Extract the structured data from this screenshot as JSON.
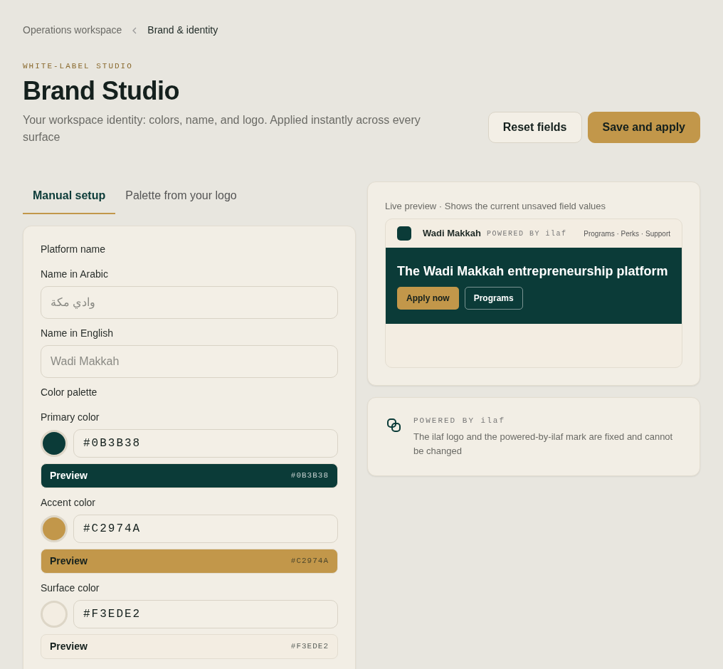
{
  "breadcrumb": [
    {
      "label": "Operations workspace",
      "current": false
    },
    {
      "label": "Brand & identity",
      "current": true
    }
  ],
  "header": {
    "eyebrow": "WHITE-LABEL STUDIO",
    "title": "Brand Studio",
    "subtitle": "Your workspace identity: colors, name, and logo. Applied instantly across every surface",
    "buttons": [
      {
        "label": "Reset fields",
        "kind": "secondary"
      },
      {
        "label": "Save and apply",
        "kind": "primary"
      }
    ]
  },
  "tabs": [
    {
      "label": "Manual setup",
      "selected": true
    },
    {
      "label": "Palette from your logo",
      "selected": false
    }
  ],
  "form": {
    "name_section": "Platform name",
    "name_fields": [
      {
        "label": "Name in Arabic",
        "placeholder": "وادي مكة"
      },
      {
        "label": "Name in English",
        "placeholder": "Wadi Makkah"
      }
    ],
    "palette_section": "Color palette",
    "colors": [
      {
        "label": "Primary color",
        "value": "#0B3B38",
        "color": "#0b3b38",
        "preview_label": "Preview",
        "preview_code": "#0B3B38"
      },
      {
        "label": "Accent color",
        "value": "#C2974A",
        "color": "#c2974a",
        "preview_label": "Preview",
        "preview_code": "#C2974A"
      },
      {
        "label": "Surface color",
        "value": "#F3EDE2",
        "color": "#f3ede2",
        "preview_label": "Preview",
        "preview_code": "#F3EDE2"
      }
    ]
  },
  "live_preview": {
    "caption": "Live preview · Shows the current unsaved field values",
    "brand_name": "Wadi Makkah",
    "powered": "POWERED BY ilaf",
    "nav": "Programs · Perks · Support",
    "hero_title": "The Wadi Makkah entrepreneurship platform",
    "hero_buttons": [
      {
        "label": "Apply now",
        "kind": "accent"
      },
      {
        "label": "Programs",
        "kind": "outline"
      }
    ]
  },
  "notice": {
    "eyebrow": "POWERED BY ilaf",
    "text": "The ilaf logo and the powered-by-ilaf mark are fixed and cannot be changed"
  }
}
